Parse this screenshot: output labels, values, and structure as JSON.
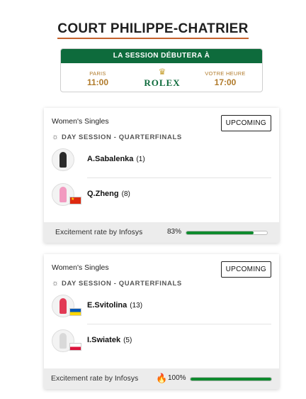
{
  "court": {
    "title": "COURT PHILIPPE-CHATRIER"
  },
  "session_info": {
    "header": "LA SESSION DÉBUTERA À",
    "left_label": "PARIS",
    "left_time": "11:00",
    "brand": "ROLEX",
    "right_label": "VOTRE HEURE",
    "right_time": "17:00"
  },
  "matches": [
    {
      "event": "Women's Singles",
      "status": "UPCOMING",
      "session": "DAY SESSION - QUARTERFINALS",
      "players": [
        {
          "name": "A.Sabalenka",
          "seed": "(1)",
          "flag": "none"
        },
        {
          "name": "Q.Zheng",
          "seed": "(8)",
          "flag": "cn"
        }
      ],
      "excitement_label": "Excitement rate by",
      "excitement_brand": "Infosys",
      "excitement_pct": "83%",
      "excitement_value": 0.83
    },
    {
      "event": "Women's Singles",
      "status": "UPCOMING",
      "session": "DAY SESSION - QUARTERFINALS",
      "players": [
        {
          "name": "E.Svitolina",
          "seed": "(13)",
          "flag": "ua"
        },
        {
          "name": "I.Swiatek",
          "seed": "(5)",
          "flag": "pl"
        }
      ],
      "excitement_label": "Excitement rate by",
      "excitement_brand": "Infosys",
      "excitement_pct": "100%",
      "excitement_value": 1.0
    }
  ],
  "colors": {
    "green": "#0e6b3c",
    "gold": "#b07a2a",
    "bar": "#0f8a2e",
    "accent": "#c4622d"
  }
}
